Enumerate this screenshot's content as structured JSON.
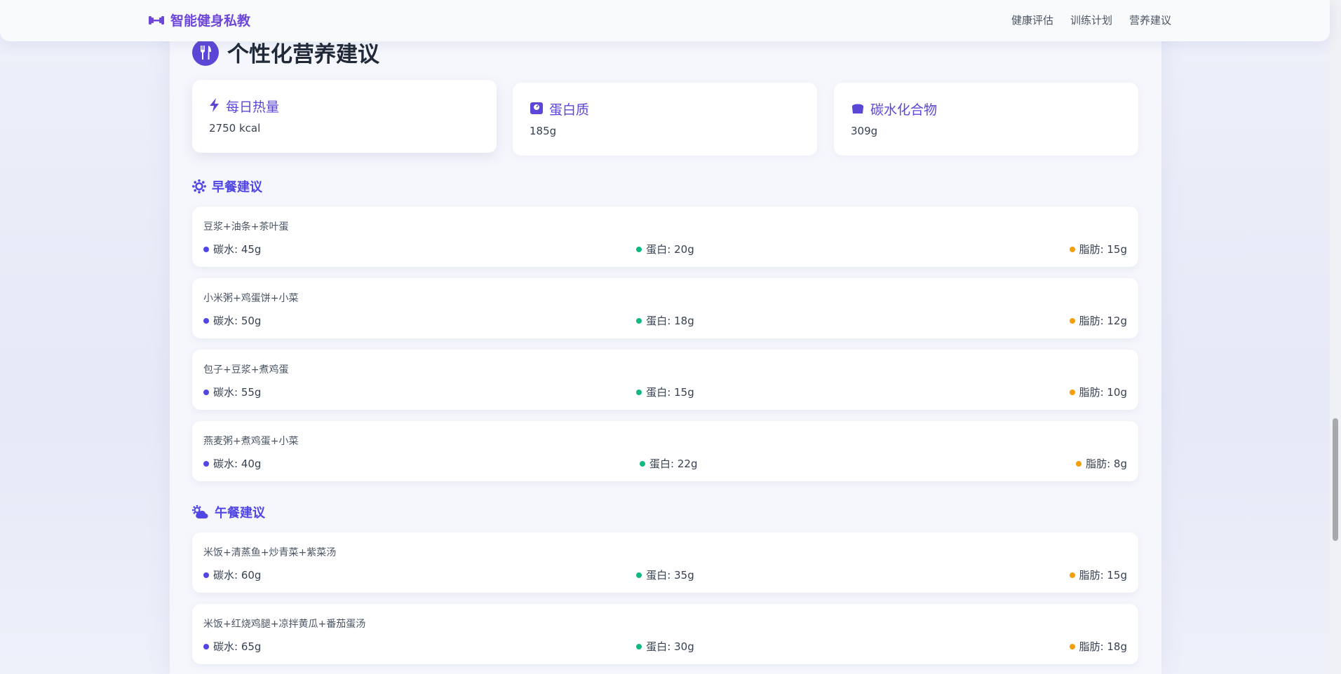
{
  "header": {
    "brand": "智能健身私教",
    "nav": [
      "健康评估",
      "训练计划",
      "营养建议"
    ]
  },
  "page_title": "个性化营养建议",
  "stats": [
    {
      "label": "每日热量",
      "value": "2750 kcal",
      "icon": "bolt-icon"
    },
    {
      "label": "蛋白质",
      "value": "185g",
      "icon": "weight-scale-icon"
    },
    {
      "label": "碳水化合物",
      "value": "309g",
      "icon": "bread-icon"
    }
  ],
  "breakfast": {
    "title": "早餐建议",
    "items": [
      {
        "name": "豆浆+油条+茶叶蛋",
        "carb": "碳水: 45g",
        "protein": "蛋白: 20g",
        "fat": "脂肪: 15g"
      },
      {
        "name": "小米粥+鸡蛋饼+小菜",
        "carb": "碳水: 50g",
        "protein": "蛋白: 18g",
        "fat": "脂肪: 12g"
      },
      {
        "name": "包子+豆浆+煮鸡蛋",
        "carb": "碳水: 55g",
        "protein": "蛋白: 15g",
        "fat": "脂肪: 10g"
      },
      {
        "name": "燕麦粥+煮鸡蛋+小菜",
        "carb": "碳水: 40g",
        "protein": "蛋白: 22g",
        "fat": "脂肪: 8g"
      }
    ]
  },
  "lunch": {
    "title": "午餐建议",
    "items": [
      {
        "name": "米饭+清蒸鱼+炒青菜+紫菜汤",
        "carb": "碳水: 60g",
        "protein": "蛋白: 35g",
        "fat": "脂肪: 15g"
      },
      {
        "name": "米饭+红烧鸡腿+凉拌黄瓜+番茄蛋汤",
        "carb": "碳水: 65g",
        "protein": "蛋白: 30g",
        "fat": "脂肪: 18g"
      }
    ]
  },
  "colors": {
    "accent": "#5b47d6",
    "carb_dot": "#4f46e5",
    "protein_dot": "#10b981",
    "fat_dot": "#f59e0b"
  }
}
